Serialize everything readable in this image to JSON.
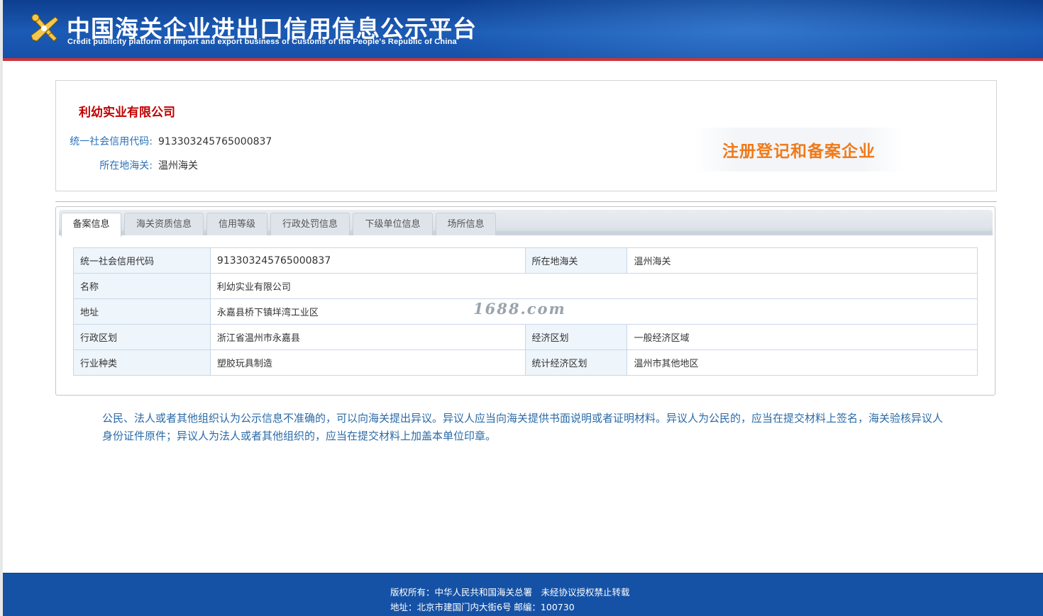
{
  "header": {
    "title": "中国海关企业进出口信用信息公示平台",
    "subtitle": "Credit publicity platform of import and export business of Customs of the People's Republic of China",
    "logo_icon": "customs-emblem-icon"
  },
  "company": {
    "name": "利幼实业有限公司",
    "credit_code_label": "统一社会信用代码:",
    "credit_code": "913303245765000837",
    "customs_label": "所在地海关:",
    "customs": "温州海关",
    "badge": "注册登记和备案企业"
  },
  "tabs": [
    {
      "label": "备案信息",
      "active": true
    },
    {
      "label": "海关资质信息",
      "active": false
    },
    {
      "label": "信用等级",
      "active": false
    },
    {
      "label": "行政处罚信息",
      "active": false
    },
    {
      "label": "下级单位信息",
      "active": false
    },
    {
      "label": "场所信息",
      "active": false
    }
  ],
  "table": {
    "row1": {
      "k1": "统一社会信用代码",
      "v1": "913303245765000837",
      "k2": "所在地海关",
      "v2": "温州海关"
    },
    "row2": {
      "k1": "名称",
      "v1": "利幼实业有限公司"
    },
    "row3": {
      "k1": "地址",
      "v1": "永嘉县桥下镇垟湾工业区"
    },
    "row4": {
      "k1": "行政区划",
      "v1": "浙江省温州市永嘉县",
      "k2": "经济区划",
      "v2": "一般经济区域"
    },
    "row5": {
      "k1": "行业种类",
      "v1": "塑胶玩具制造",
      "k2": "统计经济区划",
      "v2": "温州市其他地区"
    }
  },
  "watermark": "1688.com",
  "notice": "公民、法人或者其他组织认为公示信息不准确的，可以向海关提出异议。异议人应当向海关提供书面说明或者证明材料。异议人为公民的，应当在提交材料上签名，海关验核异议人身份证件原件；异议人为法人或者其他组织的，应当在提交材料上加盖本单位印章。",
  "footer": {
    "copyright": "版权所有：中华人民共和国海关总署　未经协议授权禁止转载",
    "address": "地址：北京市建国门内大街6号 邮编：100730"
  },
  "colors": {
    "header_blue": "#1b5bb5",
    "accent_red": "#c00000",
    "label_blue": "#2a72b8",
    "badge_orange": "#f07a1a",
    "footer_blue": "#1552a6"
  }
}
